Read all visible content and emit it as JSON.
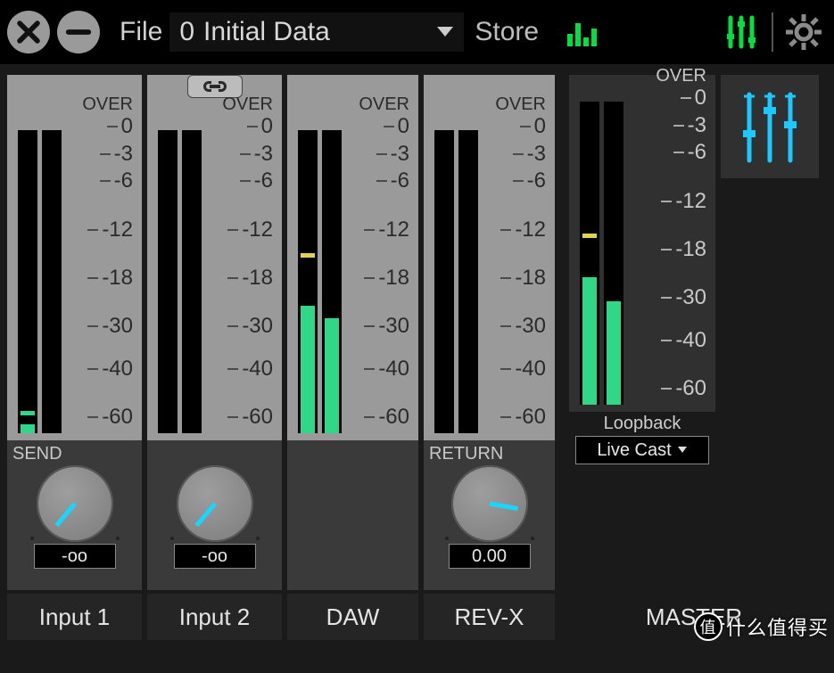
{
  "topbar": {
    "file_label": "File",
    "preset_index": "0",
    "preset_name": "Initial Data",
    "store_label": "Store"
  },
  "scale": {
    "over_label": "OVER",
    "ticks": [
      "0",
      "-3",
      "-6",
      "-12",
      "-18",
      "-30",
      "-40",
      "-60"
    ]
  },
  "channels": [
    {
      "name": "Input 1",
      "meter": {
        "left_fill_pct": 3,
        "left_peak_pct": 6,
        "peak_color": "green",
        "right_fill_pct": 0,
        "right_peak_pct": null
      },
      "knob": {
        "label": "SEND",
        "value": "-oo",
        "angle_deg": 40
      }
    },
    {
      "name": "Input 2",
      "meter": {
        "left_fill_pct": 0,
        "left_peak_pct": null,
        "right_fill_pct": 0,
        "right_peak_pct": null
      },
      "knob": {
        "label": "",
        "value": "-oo",
        "angle_deg": 40
      }
    },
    {
      "name": "DAW",
      "meter": {
        "left_fill_pct": 42,
        "left_peak_pct": 58,
        "peak_color": "yellow",
        "right_fill_pct": 38,
        "right_peak_pct": null
      },
      "knob": null
    },
    {
      "name": "REV-X",
      "meter": {
        "left_fill_pct": 0,
        "left_peak_pct": null,
        "right_fill_pct": 0,
        "right_peak_pct": null
      },
      "knob": {
        "label": "RETURN",
        "value": "0.00",
        "angle_deg": -80
      }
    }
  ],
  "master": {
    "name": "MASTER",
    "meter": {
      "left_fill_pct": 42,
      "left_peak_pct": 55,
      "peak_color": "yellow",
      "right_fill_pct": 34,
      "right_peak_pct": null
    },
    "loopback_label": "Loopback",
    "loopback_value": "Live Cast"
  },
  "watermark": "什么值得买"
}
